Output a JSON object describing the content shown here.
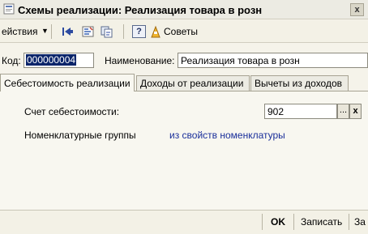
{
  "window": {
    "title": "Схемы реализации: Реализация товара в розн",
    "close_label": "x"
  },
  "toolbar": {
    "actions_label": "ействия",
    "help_label": "?",
    "tips_label": "Советы"
  },
  "form": {
    "code_label": "Код:",
    "code_value": "000000004",
    "name_label": "Наименование:",
    "name_value": "Реализация товара в розн"
  },
  "tabs": [
    {
      "label": "Себестоимость реализации",
      "active": true
    },
    {
      "label": "Доходы от реализации",
      "active": false
    },
    {
      "label": "Вычеты из доходов",
      "active": false
    }
  ],
  "cost_tab": {
    "account_label": "Счет себестоимости:",
    "account_value": "902",
    "select_button": "...",
    "clear_button": "x",
    "groups_label": "Номенклатурные группы",
    "groups_link": "из свойств номенклатуры"
  },
  "footer": {
    "ok_label": "OK",
    "save_label": "Записать",
    "close_label": "За"
  }
}
